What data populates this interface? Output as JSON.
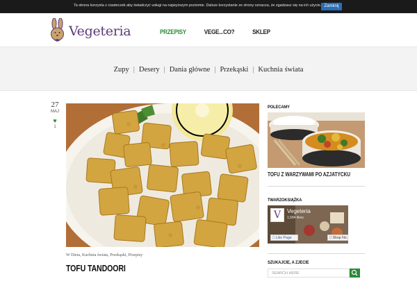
{
  "cookie_bar": {
    "text": "Ta strona korzysta z ciasteczek aby świadczyć usługi na najwyższym poziomie. Dalsze korzystanie ze strony oznacza, że zgadzasz się na ich użycie.",
    "close_label": "Zamknij"
  },
  "header": {
    "logo_text": "Vegeteria",
    "nav": [
      "PRZEPISY",
      "VEGE...CO?",
      "SKLEP"
    ]
  },
  "categories": [
    "Zupy",
    "Desery",
    "Dania główne",
    "Przekąski",
    "Kuchnia świata"
  ],
  "post": {
    "day": "27",
    "month": "MAJ",
    "likes": "1",
    "meta": "W Dieta, Kuchnia świata, Przekąski, Przepisy",
    "title": "TOFU TANDOORI"
  },
  "sidebar": {
    "recommended_heading": "POLECAMY",
    "recommended_title": "TOFU Z WARZYWAMI PO AZJATYCKU",
    "facebook_heading": "TWARZOKSIĄŻKA",
    "facebook": {
      "name": "Vegeteria",
      "likes": "1,584 likes",
      "like_label": "Like Page",
      "shop_label": "Shop No"
    },
    "search_heading": "SZUKAJCIE, A ZJECIE",
    "search_placeholder": "SEARCH HERE"
  },
  "colors": {
    "accent_green": "#2e8a38",
    "brand_purple": "#5b3a78",
    "cookie_button": "#2a6fb5"
  }
}
